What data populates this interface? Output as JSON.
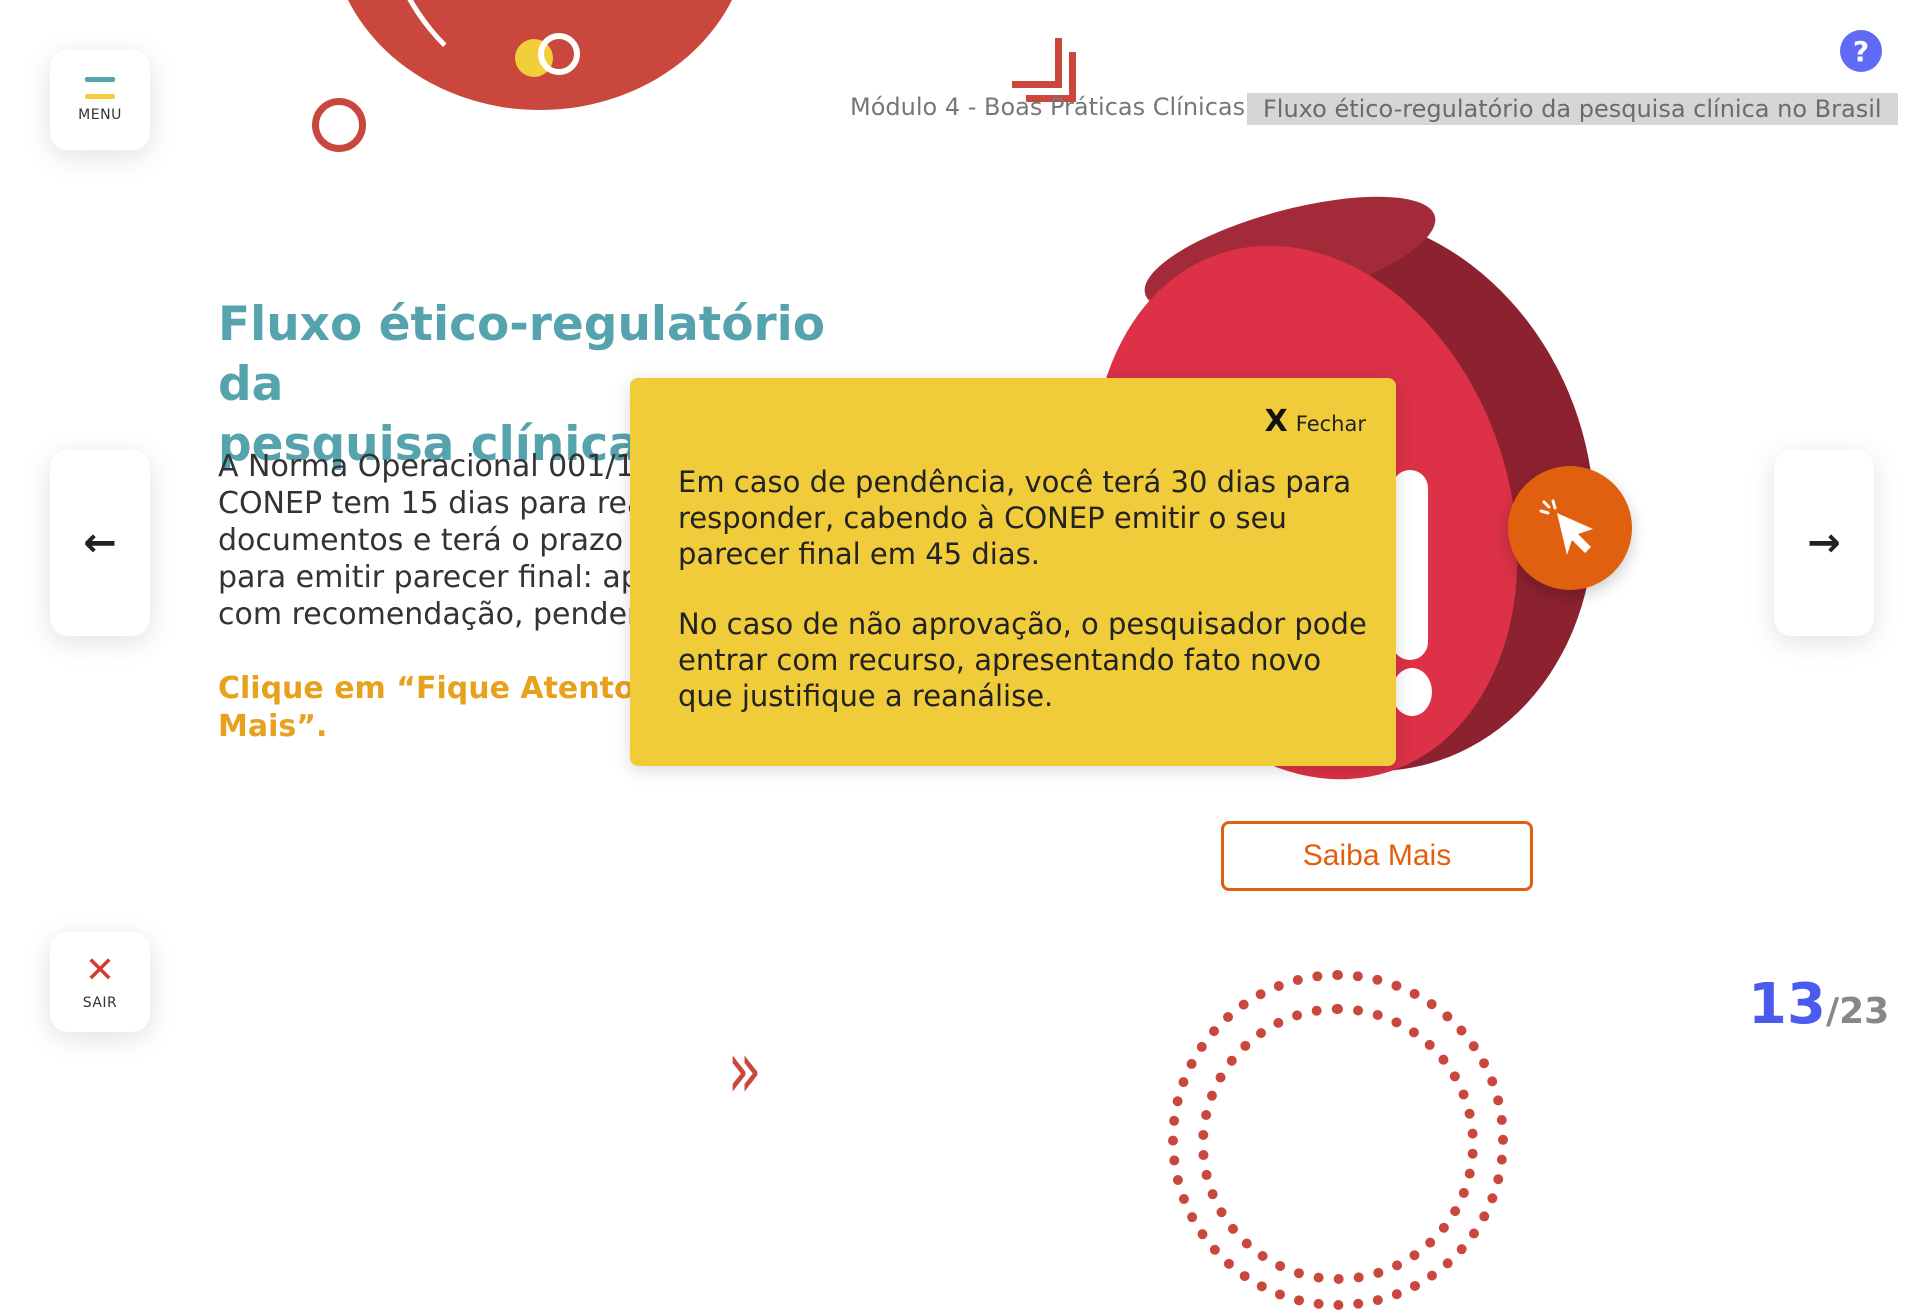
{
  "menu": {
    "label": "MENU",
    "icon": "menu-icon"
  },
  "exit": {
    "label": "SAIR",
    "icon": "close-icon",
    "glyph": "✕"
  },
  "help": {
    "glyph": "?"
  },
  "nav": {
    "prev_glyph": "←",
    "next_glyph": "→"
  },
  "breadcrumb": {
    "module": "Módulo 4 - Boas Práticas Clínicas",
    "topic": "Fluxo ético-regulatório da pesquisa clínica no Brasil"
  },
  "content": {
    "title_line1": "Fluxo ético-regulatório da",
    "title_line2": "pesquisa clínica no Brasil",
    "body_lines": [
      "A Norma Operacional 001/13",
      "CONEP tem 15 dias para reali",
      "documentos e terá o prazo m",
      "para emitir parecer final: apro",
      "com recomendação, pendent"
    ],
    "cta_line1": "Clique em “Fique Atento” e c",
    "cta_line2": "Mais”."
  },
  "saiba_mais": {
    "label": "Saiba Mais"
  },
  "popup": {
    "close_glyph": "X",
    "close_label": "Fechar",
    "paragraph1": "Em caso de pendência, você terá 30 dias para responder, cabendo à CONEP emitir o seu parecer final em 45 dias.",
    "paragraph2": "No caso de não aprovação, o pesquisador pode entrar com recurso, apresentando fato novo que justifique a reanálise."
  },
  "pager": {
    "current": "13",
    "total": "/23"
  },
  "colors": {
    "accent_teal": "#55a3ac",
    "accent_orange": "#e0600f",
    "cta_yellow": "#e8a11d",
    "popup_bg": "#f0cc3a",
    "pager_blue": "#4a5cf0",
    "deco_red": "#c9473c"
  }
}
